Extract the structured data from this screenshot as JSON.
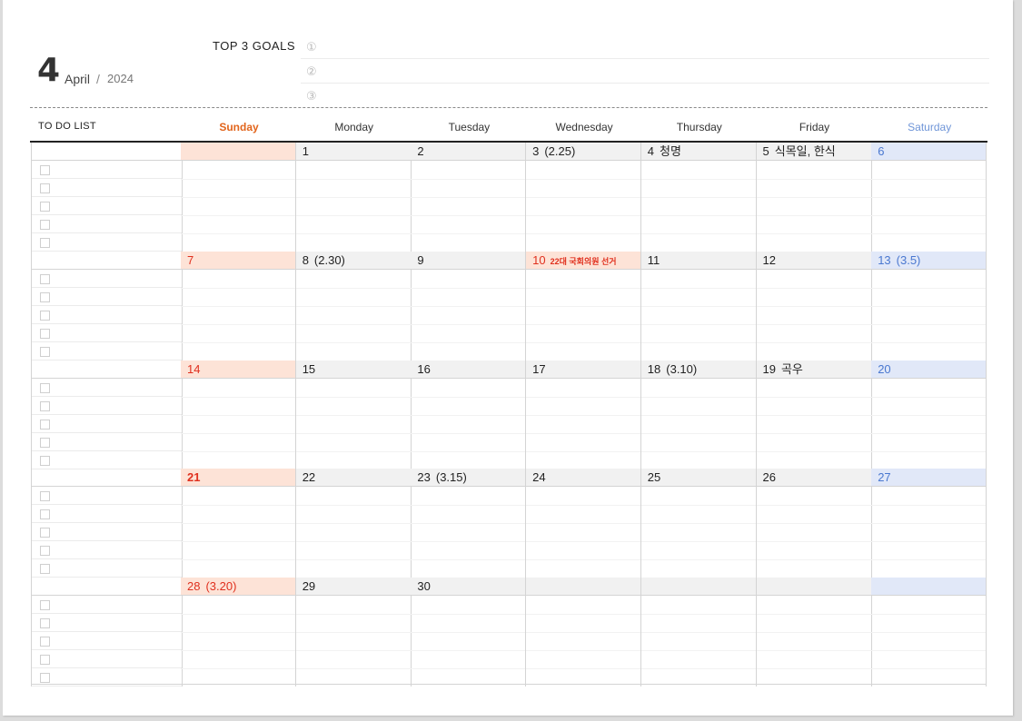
{
  "header": {
    "month_number": "4",
    "month_name": "April",
    "separator": "/",
    "year": "2024",
    "goals_title": "TOP 3 GOALS",
    "goal_markers": [
      "①",
      "②",
      "③"
    ]
  },
  "todo_title": "TO DO LIST",
  "weekdays": [
    "Sunday",
    "Monday",
    "Tuesday",
    "Wednesday",
    "Thursday",
    "Friday",
    "Saturday"
  ],
  "colors": {
    "sunday_text": "#e2651c",
    "saturday_text": "#6f95d8",
    "holiday_red": "#e0301e",
    "sunday_bg": "#fde3d7",
    "saturday_bg": "#e1e8f8",
    "weekday_bg": "#f1f1f1"
  },
  "weeks": [
    [
      {
        "num": "",
        "note": ""
      },
      {
        "num": "1",
        "note": ""
      },
      {
        "num": "2",
        "note": ""
      },
      {
        "num": "3",
        "note": "(2.25)"
      },
      {
        "num": "4",
        "note": "청명"
      },
      {
        "num": "5",
        "note": "식목일, 한식"
      },
      {
        "num": "6",
        "note": ""
      }
    ],
    [
      {
        "num": "7",
        "note": ""
      },
      {
        "num": "8",
        "note": "(2.30)"
      },
      {
        "num": "9",
        "note": ""
      },
      {
        "num": "10",
        "note": "22대 국회의원 선거"
      },
      {
        "num": "11",
        "note": ""
      },
      {
        "num": "12",
        "note": ""
      },
      {
        "num": "13",
        "note": "(3.5)"
      }
    ],
    [
      {
        "num": "14",
        "note": ""
      },
      {
        "num": "15",
        "note": ""
      },
      {
        "num": "16",
        "note": ""
      },
      {
        "num": "17",
        "note": ""
      },
      {
        "num": "18",
        "note": "(3.10)"
      },
      {
        "num": "19",
        "note": "곡우"
      },
      {
        "num": "20",
        "note": ""
      }
    ],
    [
      {
        "num": "21",
        "note": ""
      },
      {
        "num": "22",
        "note": ""
      },
      {
        "num": "23",
        "note": "(3.15)"
      },
      {
        "num": "24",
        "note": ""
      },
      {
        "num": "25",
        "note": ""
      },
      {
        "num": "26",
        "note": ""
      },
      {
        "num": "27",
        "note": ""
      }
    ],
    [
      {
        "num": "28",
        "note": "(3.20)"
      },
      {
        "num": "29",
        "note": ""
      },
      {
        "num": "30",
        "note": ""
      },
      {
        "num": "",
        "note": ""
      },
      {
        "num": "",
        "note": ""
      },
      {
        "num": "",
        "note": ""
      },
      {
        "num": "",
        "note": ""
      }
    ]
  ]
}
